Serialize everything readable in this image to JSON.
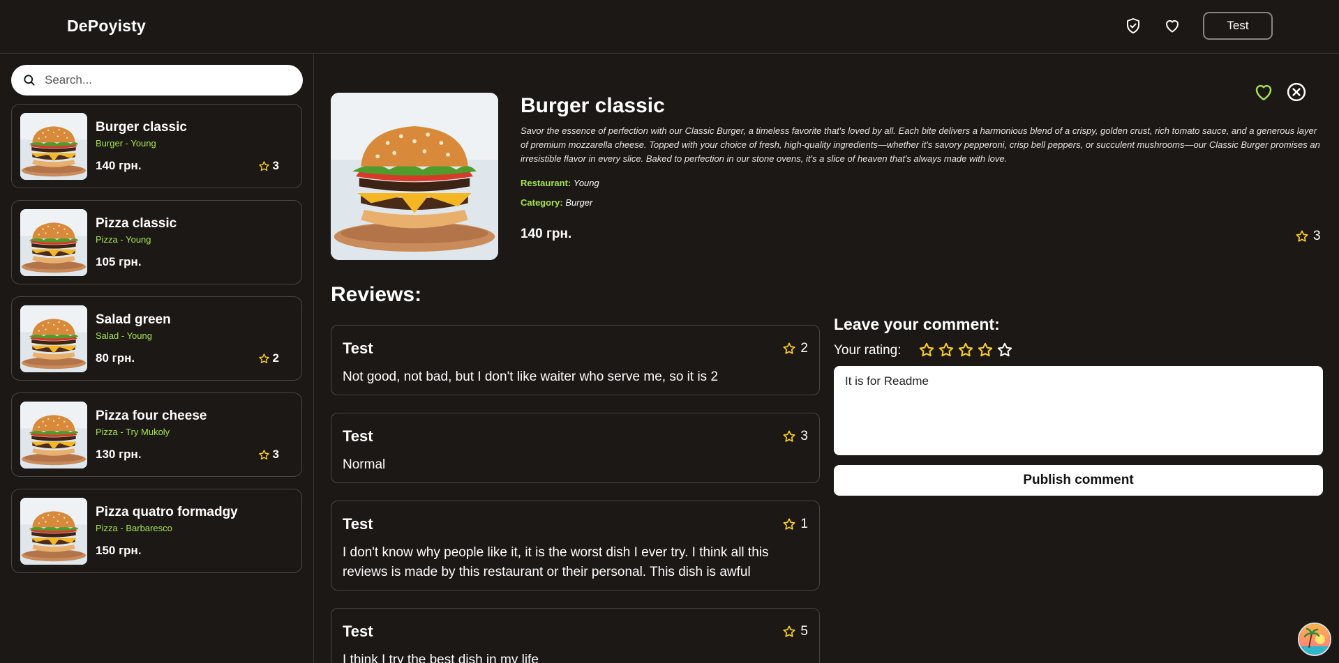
{
  "app": {
    "brand": "DePoyisty",
    "user_button": "Test"
  },
  "icons": {
    "shield": "shield-check-icon",
    "heart": "heart-icon",
    "search": "search-icon",
    "star": "star-icon",
    "close": "close-circle-icon"
  },
  "colors": {
    "accent_green": "#a6e34a",
    "star_yellow": "#ffd21f",
    "background": "#1c1816"
  },
  "search": {
    "placeholder": "Search..."
  },
  "dishes": [
    {
      "name": "Burger classic",
      "subtitle": "Burger - Young",
      "price": "140 грн.",
      "rating": "3"
    },
    {
      "name": "Pizza classic",
      "subtitle": "Pizza - Young",
      "price": "105 грн.",
      "rating": ""
    },
    {
      "name": "Salad green",
      "subtitle": "Salad - Young",
      "price": "80 грн.",
      "rating": "2"
    },
    {
      "name": "Pizza four cheese",
      "subtitle": "Pizza - Try Mukoly",
      "price": "130 грн.",
      "rating": "3"
    },
    {
      "name": "Pizza quatro formadgy",
      "subtitle": "Pizza - Barbaresco",
      "price": "150 грн.",
      "rating": ""
    }
  ],
  "detail": {
    "title": "Burger classic",
    "description": "Savor the essence of perfection with our Classic Burger, a timeless favorite that's loved by all. Each bite delivers a harmonious blend of a crispy, golden crust, rich tomato sauce, and a generous layer of premium mozzarella cheese. Topped with your choice of fresh, high-quality ingredients—whether it's savory pepperoni, crisp bell peppers, or succulent mushrooms—our Classic Burger promises an irresistible flavor in every slice. Baked to perfection in our stone ovens, it's a slice of heaven that's always made with love.",
    "restaurant_label": "Restaurant:",
    "restaurant": "Young",
    "category_label": "Category:",
    "category": "Burger",
    "price": "140 грн.",
    "rating": "3"
  },
  "reviews": {
    "title": "Reviews:",
    "items": [
      {
        "author": "Test",
        "rating": "2",
        "text": "Not good, not bad, but I don't like waiter who serve me, so it is 2"
      },
      {
        "author": "Test",
        "rating": "3",
        "text": "Normal"
      },
      {
        "author": "Test",
        "rating": "1",
        "text": "I don't know why people like it, it is the worst dish I ever try. I think all this reviews is made by this restaurant or their personal. This dish is awful"
      },
      {
        "author": "Test",
        "rating": "5",
        "text": "I think I try the best dish in my life"
      }
    ]
  },
  "comment_form": {
    "title": "Leave your comment:",
    "rating_label": "Your rating:",
    "selected_rating": 4,
    "max_rating": 5,
    "text_value": "It is for Readme",
    "publish_label": "Publish comment"
  }
}
